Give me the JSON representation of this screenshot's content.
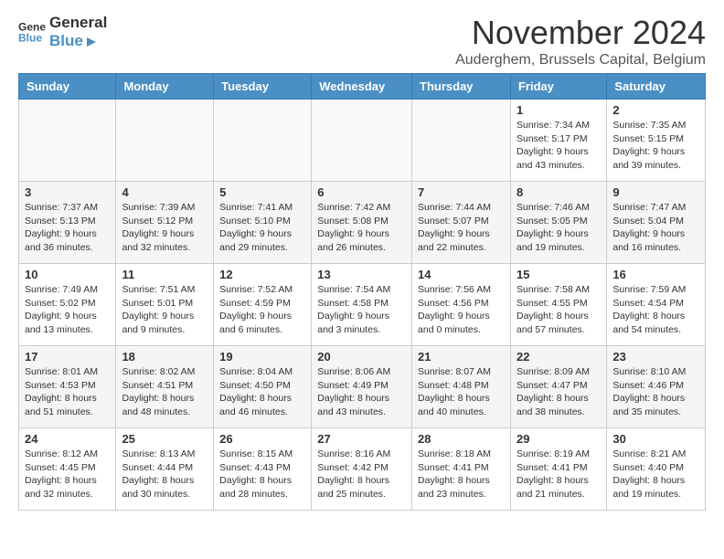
{
  "header": {
    "logo_line1": "General",
    "logo_line2": "Blue",
    "month_title": "November 2024",
    "subtitle": "Auderghem, Brussels Capital, Belgium"
  },
  "weekdays": [
    "Sunday",
    "Monday",
    "Tuesday",
    "Wednesday",
    "Thursday",
    "Friday",
    "Saturday"
  ],
  "weeks": [
    [
      {
        "day": "",
        "info": ""
      },
      {
        "day": "",
        "info": ""
      },
      {
        "day": "",
        "info": ""
      },
      {
        "day": "",
        "info": ""
      },
      {
        "day": "",
        "info": ""
      },
      {
        "day": "1",
        "info": "Sunrise: 7:34 AM\nSunset: 5:17 PM\nDaylight: 9 hours and 43 minutes."
      },
      {
        "day": "2",
        "info": "Sunrise: 7:35 AM\nSunset: 5:15 PM\nDaylight: 9 hours and 39 minutes."
      }
    ],
    [
      {
        "day": "3",
        "info": "Sunrise: 7:37 AM\nSunset: 5:13 PM\nDaylight: 9 hours and 36 minutes."
      },
      {
        "day": "4",
        "info": "Sunrise: 7:39 AM\nSunset: 5:12 PM\nDaylight: 9 hours and 32 minutes."
      },
      {
        "day": "5",
        "info": "Sunrise: 7:41 AM\nSunset: 5:10 PM\nDaylight: 9 hours and 29 minutes."
      },
      {
        "day": "6",
        "info": "Sunrise: 7:42 AM\nSunset: 5:08 PM\nDaylight: 9 hours and 26 minutes."
      },
      {
        "day": "7",
        "info": "Sunrise: 7:44 AM\nSunset: 5:07 PM\nDaylight: 9 hours and 22 minutes."
      },
      {
        "day": "8",
        "info": "Sunrise: 7:46 AM\nSunset: 5:05 PM\nDaylight: 9 hours and 19 minutes."
      },
      {
        "day": "9",
        "info": "Sunrise: 7:47 AM\nSunset: 5:04 PM\nDaylight: 9 hours and 16 minutes."
      }
    ],
    [
      {
        "day": "10",
        "info": "Sunrise: 7:49 AM\nSunset: 5:02 PM\nDaylight: 9 hours and 13 minutes."
      },
      {
        "day": "11",
        "info": "Sunrise: 7:51 AM\nSunset: 5:01 PM\nDaylight: 9 hours and 9 minutes."
      },
      {
        "day": "12",
        "info": "Sunrise: 7:52 AM\nSunset: 4:59 PM\nDaylight: 9 hours and 6 minutes."
      },
      {
        "day": "13",
        "info": "Sunrise: 7:54 AM\nSunset: 4:58 PM\nDaylight: 9 hours and 3 minutes."
      },
      {
        "day": "14",
        "info": "Sunrise: 7:56 AM\nSunset: 4:56 PM\nDaylight: 9 hours and 0 minutes."
      },
      {
        "day": "15",
        "info": "Sunrise: 7:58 AM\nSunset: 4:55 PM\nDaylight: 8 hours and 57 minutes."
      },
      {
        "day": "16",
        "info": "Sunrise: 7:59 AM\nSunset: 4:54 PM\nDaylight: 8 hours and 54 minutes."
      }
    ],
    [
      {
        "day": "17",
        "info": "Sunrise: 8:01 AM\nSunset: 4:53 PM\nDaylight: 8 hours and 51 minutes."
      },
      {
        "day": "18",
        "info": "Sunrise: 8:02 AM\nSunset: 4:51 PM\nDaylight: 8 hours and 48 minutes."
      },
      {
        "day": "19",
        "info": "Sunrise: 8:04 AM\nSunset: 4:50 PM\nDaylight: 8 hours and 46 minutes."
      },
      {
        "day": "20",
        "info": "Sunrise: 8:06 AM\nSunset: 4:49 PM\nDaylight: 8 hours and 43 minutes."
      },
      {
        "day": "21",
        "info": "Sunrise: 8:07 AM\nSunset: 4:48 PM\nDaylight: 8 hours and 40 minutes."
      },
      {
        "day": "22",
        "info": "Sunrise: 8:09 AM\nSunset: 4:47 PM\nDaylight: 8 hours and 38 minutes."
      },
      {
        "day": "23",
        "info": "Sunrise: 8:10 AM\nSunset: 4:46 PM\nDaylight: 8 hours and 35 minutes."
      }
    ],
    [
      {
        "day": "24",
        "info": "Sunrise: 8:12 AM\nSunset: 4:45 PM\nDaylight: 8 hours and 32 minutes."
      },
      {
        "day": "25",
        "info": "Sunrise: 8:13 AM\nSunset: 4:44 PM\nDaylight: 8 hours and 30 minutes."
      },
      {
        "day": "26",
        "info": "Sunrise: 8:15 AM\nSunset: 4:43 PM\nDaylight: 8 hours and 28 minutes."
      },
      {
        "day": "27",
        "info": "Sunrise: 8:16 AM\nSunset: 4:42 PM\nDaylight: 8 hours and 25 minutes."
      },
      {
        "day": "28",
        "info": "Sunrise: 8:18 AM\nSunset: 4:41 PM\nDaylight: 8 hours and 23 minutes."
      },
      {
        "day": "29",
        "info": "Sunrise: 8:19 AM\nSunset: 4:41 PM\nDaylight: 8 hours and 21 minutes."
      },
      {
        "day": "30",
        "info": "Sunrise: 8:21 AM\nSunset: 4:40 PM\nDaylight: 8 hours and 19 minutes."
      }
    ]
  ]
}
